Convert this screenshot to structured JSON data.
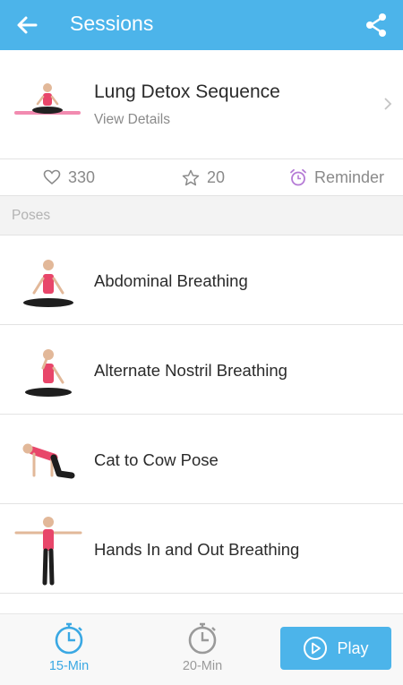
{
  "header": {
    "title": "Sessions",
    "back_icon": "arrow-left-icon",
    "share_icon": "share-icon",
    "bg_color": "#4cb4ea"
  },
  "session": {
    "name": "Lung Detox Sequence",
    "details_label": "View Details"
  },
  "stats": {
    "likes": "330",
    "stars": "20",
    "reminder_label": "Reminder"
  },
  "section_title": "Poses",
  "poses": [
    {
      "label": "Abdominal Breathing"
    },
    {
      "label": "Alternate Nostril Breathing"
    },
    {
      "label": "Cat to Cow Pose"
    },
    {
      "label": "Hands In and Out Breathing"
    }
  ],
  "bottom": {
    "tabs": [
      {
        "label": "15-Min",
        "active": true
      },
      {
        "label": "20-Min",
        "active": false
      }
    ],
    "play_label": "Play"
  },
  "colors": {
    "accent": "#4cb4ea",
    "reminder": "#b57bd6"
  }
}
